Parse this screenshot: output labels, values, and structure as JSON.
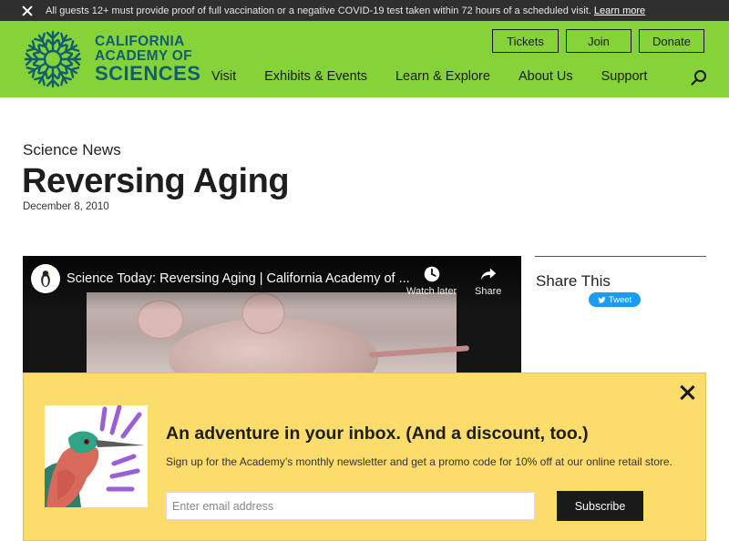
{
  "alert": {
    "text": "All guests 12+ must provide proof of full vaccination or a negative COVID-19 test taken within 72 hours of a scheduled visit.",
    "link": "Learn more"
  },
  "header": {
    "logo": {
      "line1": "CALIFORNIA",
      "line2": "ACADEMY OF",
      "line3": "SCIENCES"
    },
    "buttons": {
      "tickets": "Tickets",
      "join": "Join",
      "donate": "Donate"
    },
    "nav": [
      "Visit",
      "Exhibits & Events",
      "Learn & Explore",
      "About Us",
      "Support"
    ],
    "colors": {
      "bar": "#85d339",
      "logo": "#115d72"
    }
  },
  "article": {
    "section": "Science News",
    "title": "Reversing Aging",
    "date": "December 8, 2010"
  },
  "video": {
    "title": "Science Today: Reversing Aging | California Academy of ...",
    "watch_later": "Watch later",
    "share": "Share"
  },
  "share": {
    "title": "Share This",
    "tweet": "Tweet"
  },
  "newsletter": {
    "heading": "An adventure in your inbox. (And a discount, too.)",
    "subtext": "Sign up for the Academy’s monthly newsletter and get a promo code for 10% off at our online retail store.",
    "email_placeholder": "Enter email address",
    "submit": "Subscribe",
    "colors": {
      "background": "#fcdc6b"
    }
  }
}
